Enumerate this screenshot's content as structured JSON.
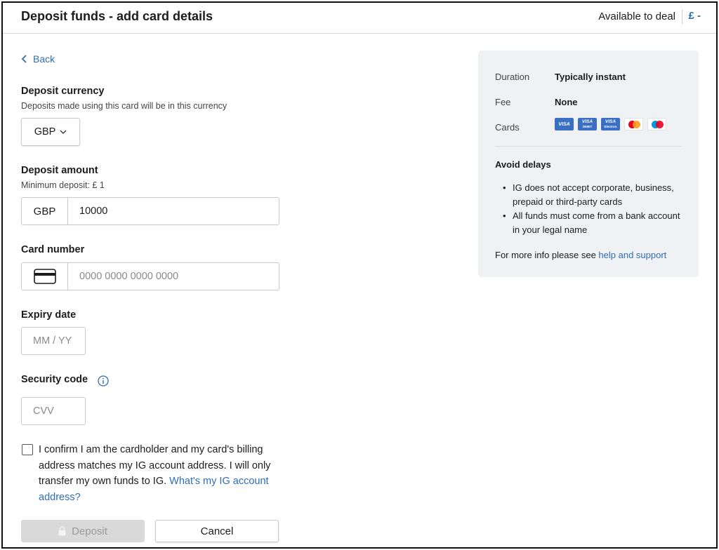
{
  "header": {
    "title": "Deposit funds - add card details",
    "available_label": "Available to deal",
    "available_value": "£ -"
  },
  "back": {
    "label": "Back"
  },
  "currency": {
    "label": "Deposit currency",
    "hint": "Deposits made using this card will be in this currency",
    "selected": "GBP"
  },
  "amount": {
    "label": "Deposit amount",
    "hint": "Minimum deposit: £ 1",
    "prefix": "GBP",
    "value": "10000"
  },
  "card_number": {
    "label": "Card number",
    "placeholder": "0000 0000 0000 0000",
    "icon": "credit-card-icon"
  },
  "expiry": {
    "label": "Expiry date",
    "placeholder": "MM / YY"
  },
  "security": {
    "label": "Security code",
    "placeholder": "CVV",
    "icon": "info-icon"
  },
  "confirm": {
    "text": "I confirm I am the cardholder and my card's billing address matches my IG account address. I will only transfer my own funds to IG.",
    "link": "What's my IG account address?"
  },
  "buttons": {
    "deposit": "Deposit",
    "cancel": "Cancel"
  },
  "panel": {
    "duration_label": "Duration",
    "duration_value": "Typically instant",
    "fee_label": "Fee",
    "fee_value": "None",
    "cards_label": "Cards",
    "card_logos": [
      {
        "name": "visa",
        "text": "VISA"
      },
      {
        "name": "visa-debit",
        "text": "VISA",
        "sub": "DEBIT"
      },
      {
        "name": "visa-electron",
        "text": "VISA",
        "sub": "Electron"
      },
      {
        "name": "mastercard"
      },
      {
        "name": "maestro"
      }
    ],
    "avoid_title": "Avoid delays",
    "bullets": [
      "IG does not accept corporate, business, prepaid or third-party cards",
      "All funds must come from a bank account in your legal name"
    ],
    "more_info_text": "For more info please see",
    "more_info_link": "help and support"
  },
  "colors": {
    "accent": "#2f6db5",
    "panel_bg": "#f0f1f3",
    "disabled_button": "#d9d9d9"
  }
}
